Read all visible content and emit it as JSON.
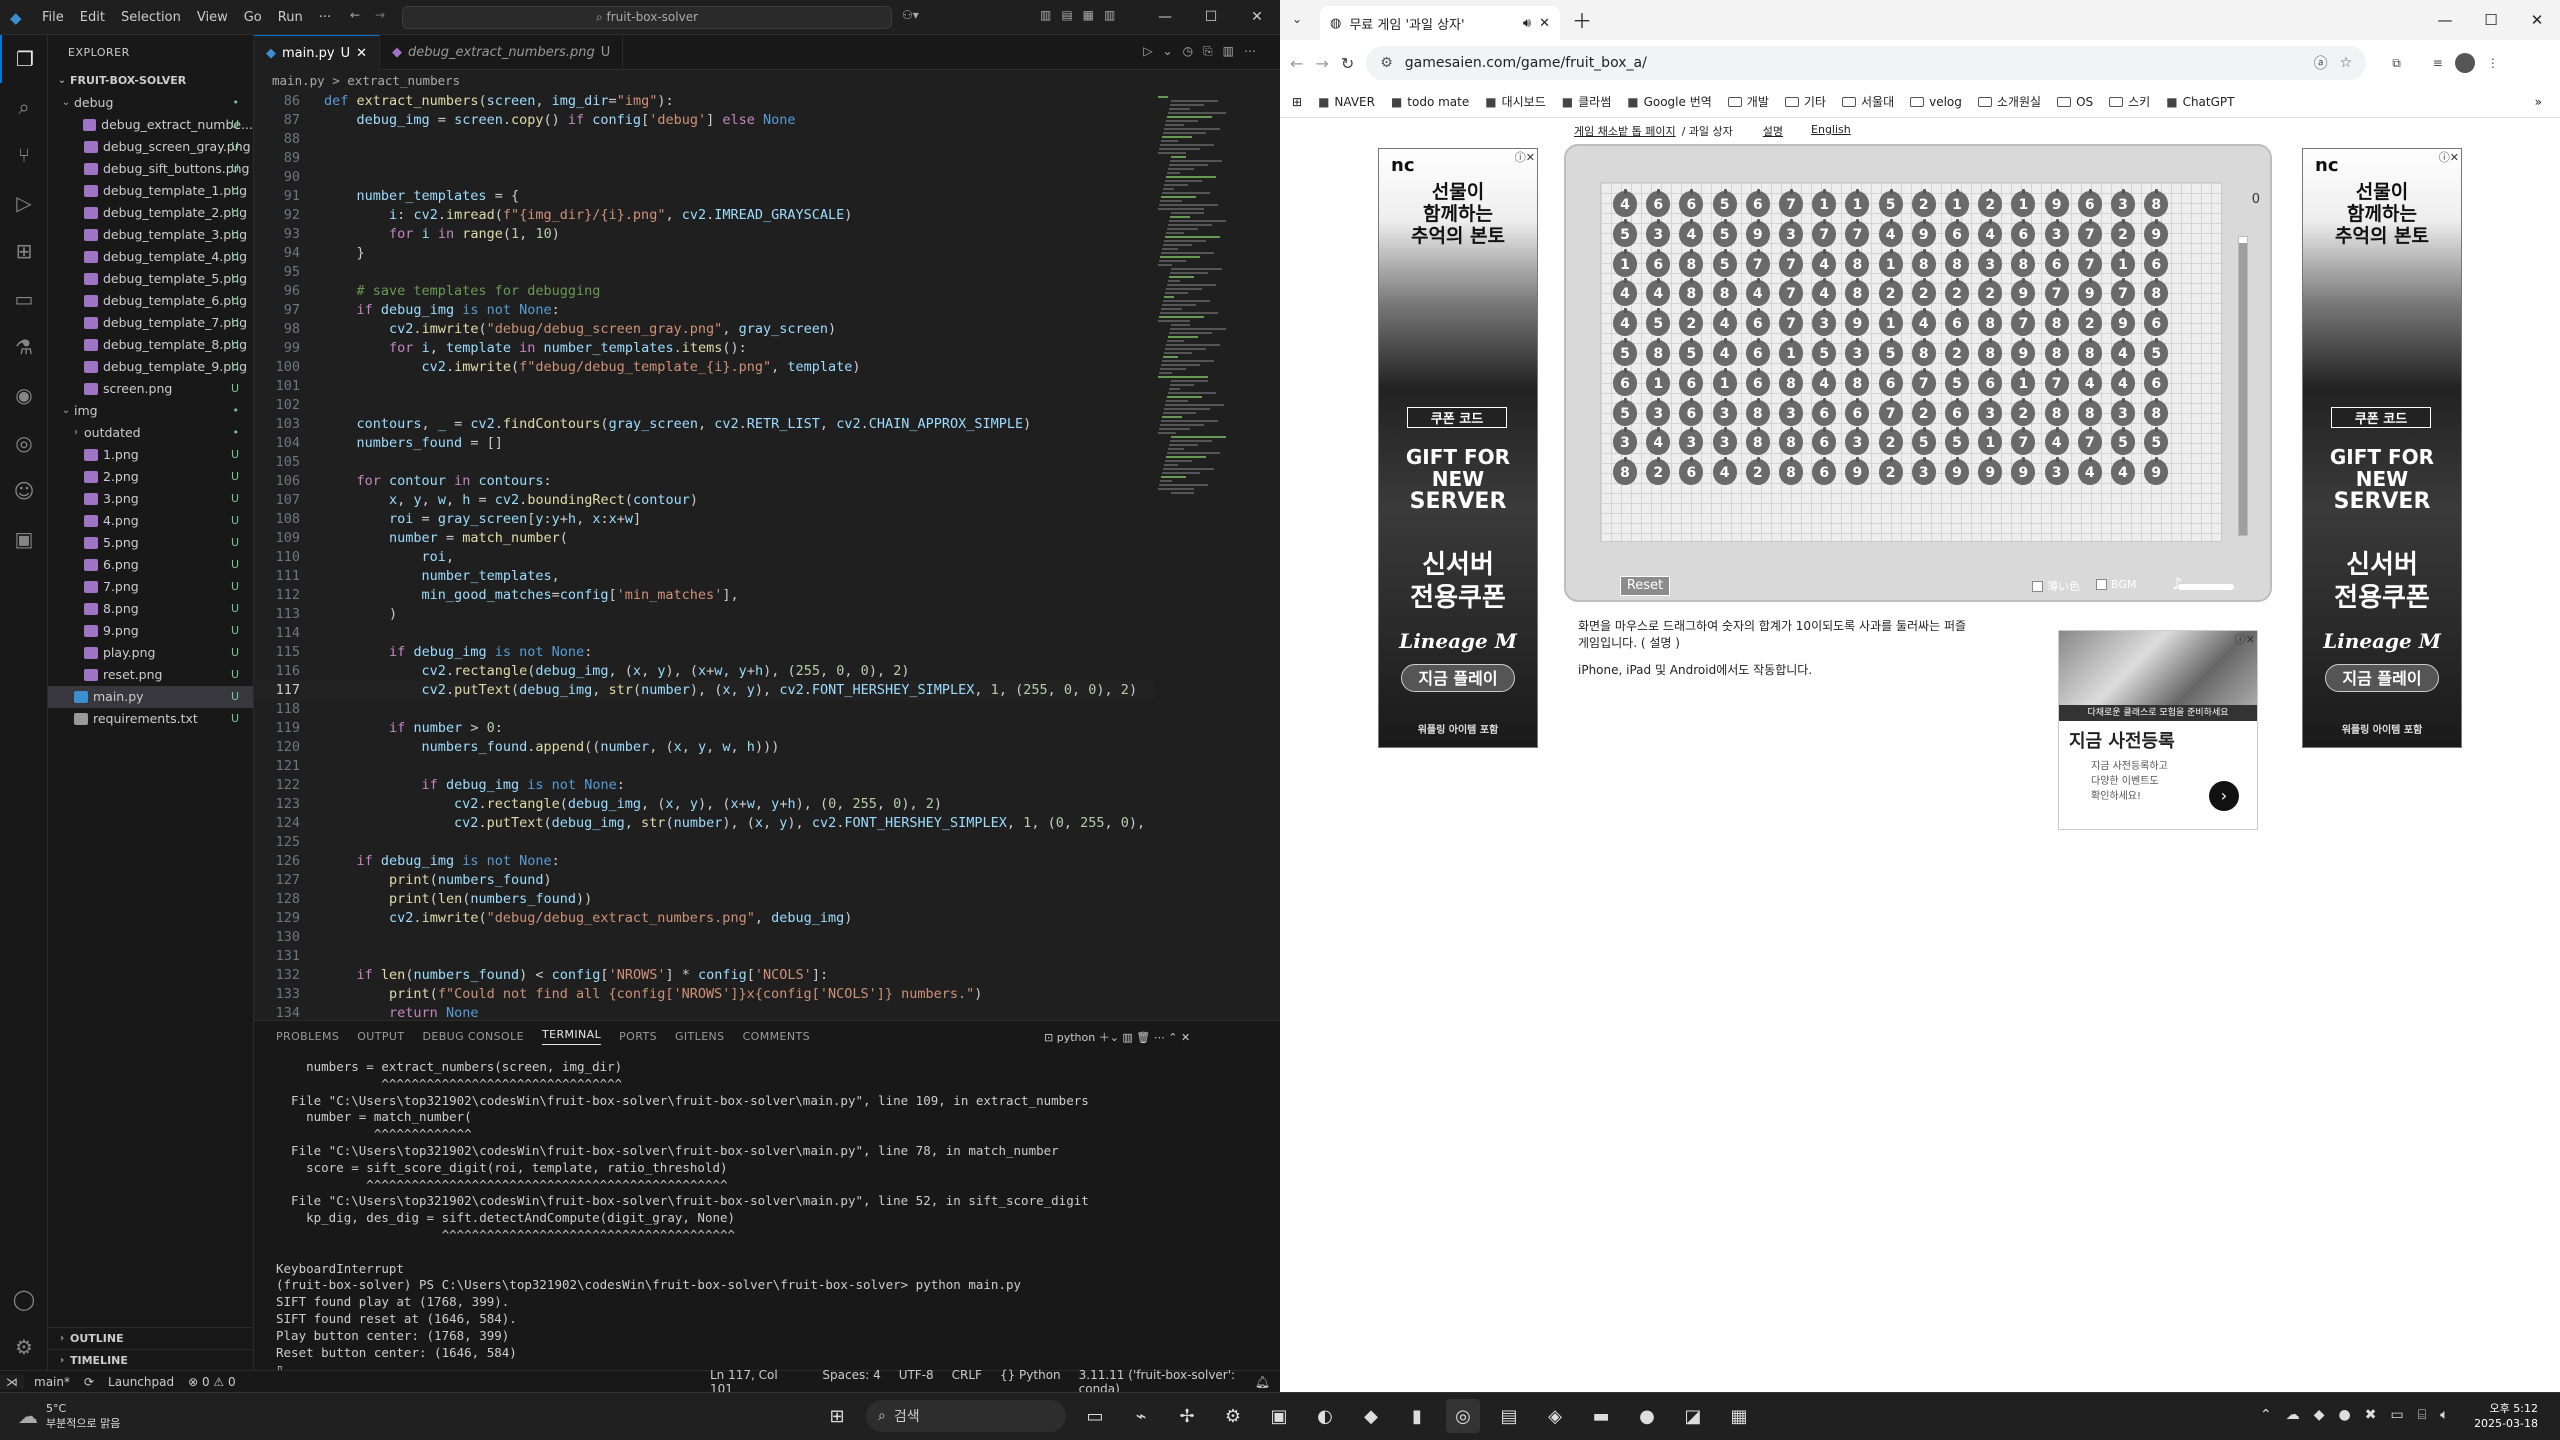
{
  "vscode": {
    "menu": [
      "File",
      "Edit",
      "Selection",
      "View",
      "Go",
      "Run",
      "···"
    ],
    "command_center": "fruit-box-solver",
    "explorer_title": "EXPLORER",
    "project": "FRUIT-BOX-SOLVER",
    "tree": [
      {
        "name": "debug",
        "type": "folder",
        "indent": 1,
        "open": true,
        "badge": "•"
      },
      {
        "name": "debug_extract_numbe...",
        "indent": 2,
        "badge": "U",
        "color": "#a074c4"
      },
      {
        "name": "debug_screen_gray.png",
        "indent": 2,
        "badge": "U",
        "color": "#a074c4"
      },
      {
        "name": "debug_sift_buttons.png",
        "indent": 2,
        "badge": "U",
        "color": "#a074c4"
      },
      {
        "name": "debug_template_1.png",
        "indent": 2,
        "badge": "U",
        "color": "#a074c4"
      },
      {
        "name": "debug_template_2.png",
        "indent": 2,
        "badge": "U",
        "color": "#a074c4"
      },
      {
        "name": "debug_template_3.png",
        "indent": 2,
        "badge": "U",
        "color": "#a074c4"
      },
      {
        "name": "debug_template_4.png",
        "indent": 2,
        "badge": "U",
        "color": "#a074c4"
      },
      {
        "name": "debug_template_5.png",
        "indent": 2,
        "badge": "U",
        "color": "#a074c4"
      },
      {
        "name": "debug_template_6.png",
        "indent": 2,
        "badge": "U",
        "color": "#a074c4"
      },
      {
        "name": "debug_template_7.png",
        "indent": 2,
        "badge": "U",
        "color": "#a074c4"
      },
      {
        "name": "debug_template_8.png",
        "indent": 2,
        "badge": "U",
        "color": "#a074c4"
      },
      {
        "name": "debug_template_9.png",
        "indent": 2,
        "badge": "U",
        "color": "#a074c4"
      },
      {
        "name": "screen.png",
        "indent": 2,
        "badge": "U",
        "color": "#a074c4"
      },
      {
        "name": "img",
        "type": "folder",
        "indent": 1,
        "open": true,
        "badge": "•"
      },
      {
        "name": "outdated",
        "type": "folder",
        "indent": 2,
        "open": false,
        "badge": "•"
      },
      {
        "name": "1.png",
        "indent": 2,
        "badge": "U",
        "color": "#a074c4"
      },
      {
        "name": "2.png",
        "indent": 2,
        "badge": "U",
        "color": "#a074c4"
      },
      {
        "name": "3.png",
        "indent": 2,
        "badge": "U",
        "color": "#a074c4"
      },
      {
        "name": "4.png",
        "indent": 2,
        "badge": "U",
        "color": "#a074c4"
      },
      {
        "name": "5.png",
        "indent": 2,
        "badge": "U",
        "color": "#a074c4"
      },
      {
        "name": "6.png",
        "indent": 2,
        "badge": "U",
        "color": "#a074c4"
      },
      {
        "name": "7.png",
        "indent": 2,
        "badge": "U",
        "color": "#a074c4"
      },
      {
        "name": "8.png",
        "indent": 2,
        "badge": "U",
        "color": "#a074c4"
      },
      {
        "name": "9.png",
        "indent": 2,
        "badge": "U",
        "color": "#a074c4"
      },
      {
        "name": "play.png",
        "indent": 2,
        "badge": "U",
        "color": "#a074c4"
      },
      {
        "name": "reset.png",
        "indent": 2,
        "badge": "U",
        "color": "#a074c4"
      },
      {
        "name": "main.py",
        "indent": 1,
        "badge": "U",
        "color": "#3b8ed0",
        "selected": true
      },
      {
        "name": "requirements.txt",
        "indent": 1,
        "badge": "U",
        "color": "#999"
      }
    ],
    "outline": "OUTLINE",
    "timeline": "TIMELINE",
    "tabs": [
      {
        "label": "main.py",
        "badge": "U",
        "active": true
      },
      {
        "label": "debug_extract_numbers.png",
        "badge": "U",
        "active": false
      }
    ],
    "breadcrumb": [
      "main.py",
      ">",
      "extract_numbers"
    ],
    "code_start_line": 86,
    "current_line": 117,
    "code": [
      "def extract_numbers(screen, img_dir=\"img\"):",
      "    debug_img = screen.copy() if config['debug'] else None",
      "",
      "",
      "",
      "    number_templates = {",
      "        i: cv2.imread(f\"{img_dir}/{i}.png\", cv2.IMREAD_GRAYSCALE)",
      "        for i in range(1, 10)",
      "    }",
      "",
      "    # save templates for debugging",
      "    if debug_img is not None:",
      "        cv2.imwrite(\"debug/debug_screen_gray.png\", gray_screen)",
      "        for i, template in number_templates.items():",
      "            cv2.imwrite(f\"debug/debug_template_{i}.png\", template)",
      "",
      "",
      "    contours, _ = cv2.findContours(gray_screen, cv2.RETR_LIST, cv2.CHAIN_APPROX_SIMPLE)",
      "    numbers_found = []",
      "",
      "    for contour in contours:",
      "        x, y, w, h = cv2.boundingRect(contour)",
      "        roi = gray_screen[y:y+h, x:x+w]",
      "        number = match_number(",
      "            roi,",
      "            number_templates,",
      "            min_good_matches=config['min_matches'],",
      "        )",
      "",
      "        if debug_img is not None:",
      "            cv2.rectangle(debug_img, (x, y), (x+w, y+h), (255, 0, 0), 2)",
      "            cv2.putText(debug_img, str(number), (x, y), cv2.FONT_HERSHEY_SIMPLEX, 1, (255, 0, 0), 2)",
      "",
      "        if number > 0:",
      "            numbers_found.append((number, (x, y, w, h)))",
      "",
      "            if debug_img is not None:",
      "                cv2.rectangle(debug_img, (x, y), (x+w, y+h), (0, 255, 0), 2)",
      "                cv2.putText(debug_img, str(number), (x, y), cv2.FONT_HERSHEY_SIMPLEX, 1, (0, 255, 0), 2)",
      "",
      "    if debug_img is not None:",
      "        print(numbers_found)",
      "        print(len(numbers_found))",
      "        cv2.imwrite(\"debug/debug_extract_numbers.png\", debug_img)",
      "",
      "",
      "    if len(numbers_found) < config['NROWS'] * config['NCOLS']:",
      "        print(f\"Could not find all {config['NROWS']}x{config['NCOLS']} numbers.\")",
      "        return None",
      "    return numbers_found"
    ],
    "panel_tabs": [
      "PROBLEMS",
      "OUTPUT",
      "DEBUG CONSOLE",
      "TERMINAL",
      "PORTS",
      "GITLENS",
      "COMMENTS"
    ],
    "active_panel": "TERMINAL",
    "terminal_shell": "python",
    "terminal": [
      "    numbers = extract_numbers(screen, img_dir)",
      "              ^^^^^^^^^^^^^^^^^^^^^^^^^^^^^^^^",
      "  File \"C:\\Users\\top321902\\codesWin\\fruit-box-solver\\fruit-box-solver\\main.py\", line 109, in extract_numbers",
      "    number = match_number(",
      "             ^^^^^^^^^^^^^",
      "  File \"C:\\Users\\top321902\\codesWin\\fruit-box-solver\\fruit-box-solver\\main.py\", line 78, in match_number",
      "    score = sift_score_digit(roi, template, ratio_threshold)",
      "            ^^^^^^^^^^^^^^^^^^^^^^^^^^^^^^^^^^^^^^^^^^^^^^^^",
      "  File \"C:\\Users\\top321902\\codesWin\\fruit-box-solver\\fruit-box-solver\\main.py\", line 52, in sift_score_digit",
      "    kp_dig, des_dig = sift.detectAndCompute(digit_gray, None)",
      "                      ^^^^^^^^^^^^^^^^^^^^^^^^^^^^^^^^^^^^^^^",
      "",
      "KeyboardInterrupt",
      "(fruit-box-solver) PS C:\\Users\\top321902\\codesWin\\fruit-box-solver\\fruit-box-solver> python main.py",
      "SIFT found play at (1768, 399).",
      "SIFT found reset at (1646, 584).",
      "Play button center: (1768, 399)",
      "Reset button center: (1646, 584)",
      "▯"
    ],
    "status_left": [
      "main*",
      "⟳",
      "Launchpad",
      "⊗ 0 ⚠ 0"
    ],
    "status_right": [
      "Ln 117, Col 101",
      "Spaces: 4",
      "UTF-8",
      "CRLF",
      "{} Python",
      "3.11.11 ('fruit-box-solver': conda)"
    ]
  },
  "chrome": {
    "tab_title": "무료 게임 '과일 상자'",
    "url": "gamesaien.com/game/fruit_box_a/",
    "bookmarks": [
      "NAVER",
      "todo mate",
      "대시보드",
      "클라썸",
      "Google 번역",
      "개발",
      "기타",
      "서울대",
      "velog",
      "소개원실",
      "OS",
      "스키",
      "ChatGPT"
    ],
    "crumbs": [
      "게임 채소밭 톱 페이지",
      "/ 과일 상자",
      "설명",
      "English"
    ],
    "game": {
      "score": "0",
      "time_fraction": 0.98,
      "reset_label": "Reset",
      "light_label": "薄い色",
      "bgm_label": "BGM",
      "grid": [
        [
          4,
          6,
          6,
          5,
          6,
          7,
          1,
          1,
          5,
          2,
          1,
          2,
          1,
          9,
          6,
          3,
          8
        ],
        [
          5,
          3,
          4,
          5,
          9,
          3,
          7,
          7,
          4,
          9,
          6,
          4,
          6,
          3,
          7,
          2,
          9
        ],
        [
          1,
          6,
          8,
          5,
          7,
          7,
          4,
          8,
          1,
          8,
          8,
          3,
          8,
          6,
          7,
          1,
          6
        ],
        [
          4,
          4,
          8,
          8,
          4,
          7,
          4,
          8,
          2,
          2,
          2,
          2,
          9,
          7,
          9,
          7,
          8
        ],
        [
          4,
          5,
          2,
          4,
          6,
          7,
          3,
          9,
          1,
          4,
          6,
          8,
          7,
          8,
          2,
          9,
          6
        ],
        [
          5,
          8,
          5,
          4,
          6,
          1,
          5,
          3,
          5,
          8,
          2,
          8,
          9,
          8,
          8,
          4,
          5
        ],
        [
          6,
          1,
          6,
          1,
          6,
          8,
          4,
          8,
          6,
          7,
          5,
          6,
          1,
          7,
          4,
          4,
          6
        ],
        [
          5,
          3,
          6,
          3,
          8,
          3,
          6,
          6,
          7,
          2,
          6,
          3,
          2,
          8,
          8,
          3,
          8
        ],
        [
          3,
          4,
          3,
          3,
          8,
          8,
          6,
          3,
          2,
          5,
          5,
          1,
          7,
          4,
          7,
          5,
          5
        ],
        [
          8,
          2,
          6,
          4,
          2,
          8,
          6,
          9,
          2,
          3,
          9,
          9,
          9,
          3,
          4,
          4,
          9
        ]
      ]
    },
    "desc1": "화면을 마우스로 드래그하여 숫자의 합계가 10이되도록 사과를 둘러싸는 퍼즐 게임입니다. ( 설명 )",
    "desc2": "iPhone, iPad 및 Android에서도 작동합니다.",
    "ad_left": {
      "brand": "nc",
      "line1": "선물이",
      "line2": "함께하는",
      "line3": "추억의 본토",
      "coupon": "쿠폰 코드",
      "gift1": "GIFT FOR",
      "gift2": "NEW",
      "gift3": "SERVER",
      "big1": "신서버",
      "big2": "전용쿠폰",
      "logo": "Lineage M",
      "cta": "지금 플레이",
      "foot": "워플링 아이템 포함"
    },
    "sq_ad": {
      "banner": "다채로운 클래스로 모험을 준비하세요",
      "title": "지금 사전등록",
      "sub1": "지금 사전등록하고",
      "sub2": "다양한 이벤트도",
      "sub3": "확인하세요!"
    }
  },
  "taskbar": {
    "weather_temp": "5°C",
    "weather_text": "부분적으로 맑음",
    "search_placeholder": "검색",
    "time": "오후 5:12",
    "date": "2025-03-18"
  }
}
